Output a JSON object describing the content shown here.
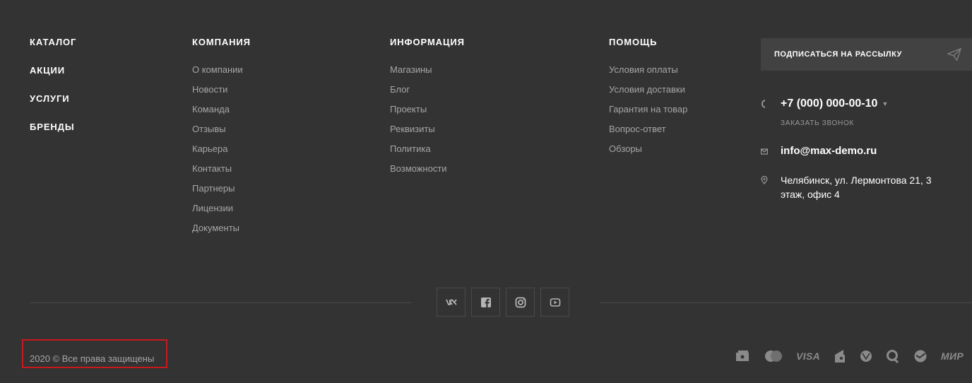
{
  "nav": {
    "main": [
      "КАТАЛОГ",
      "АКЦИИ",
      "УСЛУГИ",
      "БРЕНДЫ"
    ],
    "company": {
      "title": "КОМПАНИЯ",
      "items": [
        "О компании",
        "Новости",
        "Команда",
        "Отзывы",
        "Карьера",
        "Контакты",
        "Партнеры",
        "Лицензии",
        "Документы"
      ]
    },
    "info": {
      "title": "ИНФОРМАЦИЯ",
      "items": [
        "Магазины",
        "Блог",
        "Проекты",
        "Реквизиты",
        "Политика",
        "Возможности"
      ]
    },
    "help": {
      "title": "ПОМОЩЬ",
      "items": [
        "Условия оплаты",
        "Условия доставки",
        "Гарантия на товар",
        "Вопрос-ответ",
        "Обзоры"
      ]
    }
  },
  "subscribe": {
    "label": "ПОДПИСАТЬСЯ НА РАССЫЛКУ",
    "icon": "paper-plane-icon"
  },
  "contacts": {
    "phone": "+7 (000) 000-00-10",
    "callback": "ЗАКАЗАТЬ ЗВОНОК",
    "email": "info@max-demo.ru",
    "address": "Челябинск, ул. Лермонтова 21, 3 этаж, офис 4"
  },
  "socials": [
    "vk-icon",
    "facebook-icon",
    "instagram-icon",
    "youtube-icon"
  ],
  "payments": {
    "icons": [
      "cash-icon",
      "mastercard-icon",
      "visa-icon",
      "yandex-money-icon",
      "webmoney-icon",
      "qiwi-icon",
      "sberbank-icon",
      "mir-icon"
    ],
    "visa_label": "VISA",
    "mir_label": "МИР"
  },
  "footer": {
    "copyright": "2020 © Все права защищены"
  },
  "colors": {
    "background": "#333333",
    "highlight_border": "#c8181e",
    "muted_text": "#a6a6a6"
  }
}
